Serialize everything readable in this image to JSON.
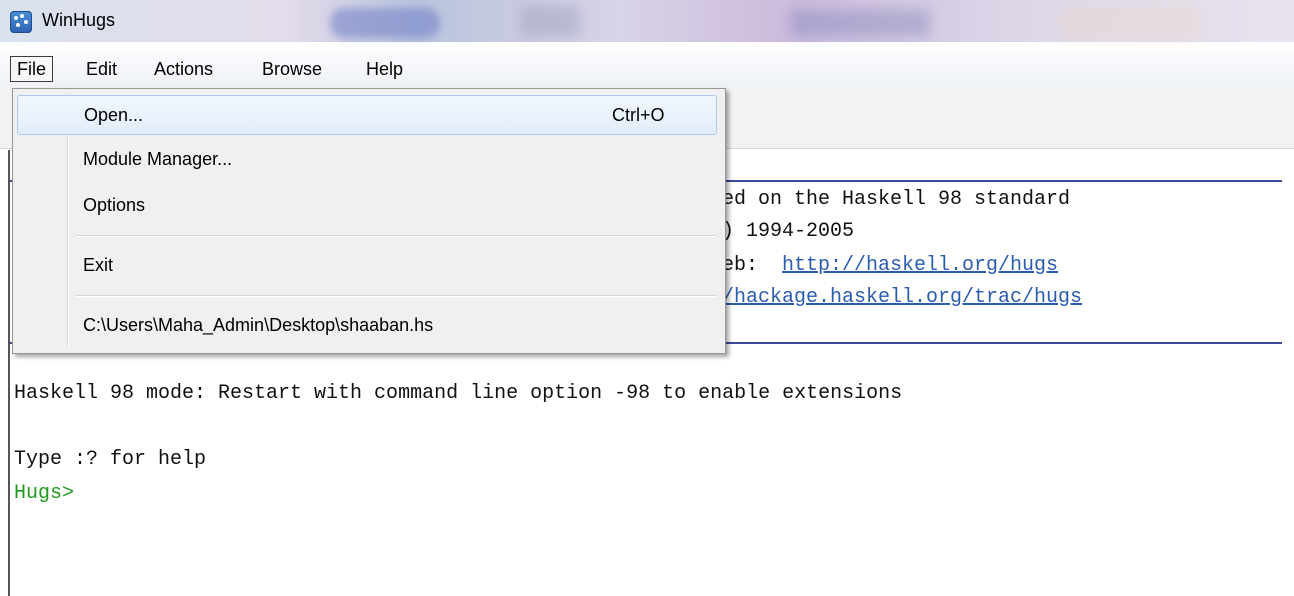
{
  "window": {
    "title": "WinHugs"
  },
  "menubar": {
    "items": [
      "File",
      "Edit",
      "Actions",
      "Browse",
      "Help"
    ]
  },
  "file_menu": {
    "open_label": "Open...",
    "open_shortcut": "Ctrl+O",
    "module_manager_label": "Module Manager...",
    "options_label": "Options",
    "exit_label": "Exit",
    "recent_file": "C:\\Users\\Maha_Admin\\Desktop\\shaaban.hs"
  },
  "console": {
    "banner_line1": "ed on the Haskell 98 standard",
    "banner_line2": ") 1994-2005",
    "banner_line3_prefix": "eb: ",
    "banner_line3_link": "http://haskell.org/hugs",
    "banner_line4_link": "/hackage.haskell.org/trac/hugs",
    "mode_line": "Haskell 98 mode: Restart with command line option -98 to enable extensions",
    "help_line": "Type :? for help",
    "prompt": "Hugs>"
  },
  "colors": {
    "link": "#2a5db0",
    "prompt": "#1f9a1f",
    "rule": "#3a4a94"
  }
}
